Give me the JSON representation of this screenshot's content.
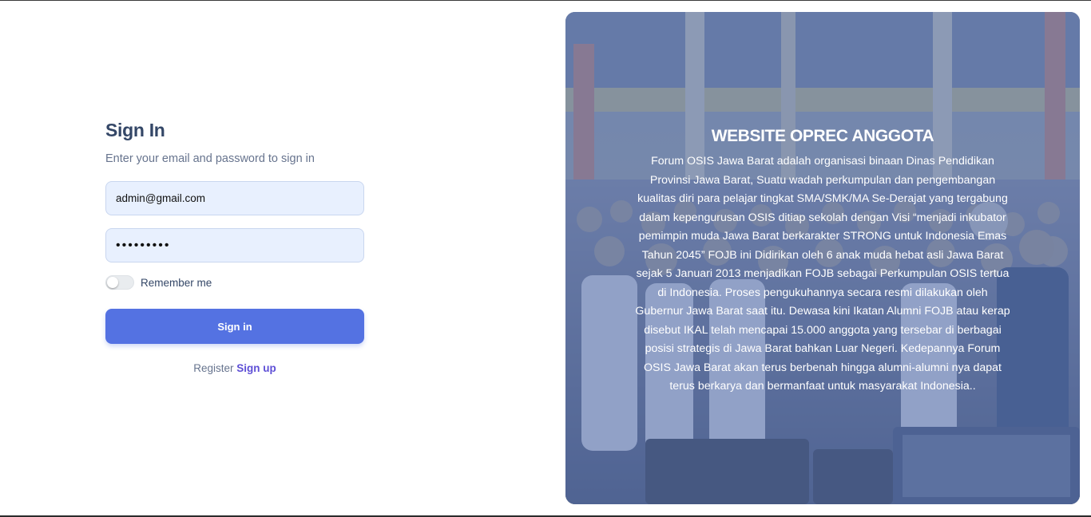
{
  "signin": {
    "title": "Sign In",
    "subtitle": "Enter your email and password to sign in",
    "email_value": "admin@gmail.com",
    "password_value": "•••••••••",
    "remember_label": "Remember me",
    "remember_checked": false,
    "button_label": "Sign in",
    "register_prefix": "Register",
    "signup_link": "Sign up"
  },
  "hero": {
    "title": "WEBSITE OPREC ANGGOTA",
    "text": "Forum OSIS Jawa Barat adalah organisasi binaan Dinas Pendidikan Provinsi Jawa Barat, Suatu wadah perkumpulan dan pengembangan kualitas diri para pelajar tingkat SMA/SMK/MA Se-Derajat yang tergabung dalam kepengurusan OSIS ditiap sekolah dengan Visi “menjadi inkubator pemimpin muda Jawa Barat berkarakter STRONG untuk Indonesia Emas Tahun 2045” FOJB ini Didirikan oleh 6 anak muda hebat asli Jawa Barat sejak 5 Januari 2013 menjadikan FOJB sebagai Perkumpulan OSIS tertua di Indonesia. Proses pengukuhannya secara resmi dilakukan oleh Gubernur Jawa Barat saat itu. Dewasa kini Ikatan Alumni FOJB atau kerap disebut IKAL telah mencapai 15.000 anggota yang tersebar di berbagai posisi strategis di Jawa Barat bahkan Luar Negeri. Kedepannya Forum OSIS Jawa Barat akan terus berbenah hingga alumni-alumni nya dapat terus berkarya dan bermanfaat untuk masyarakat Indonesia..",
    "image": "group-photo-students"
  },
  "colors": {
    "primary": "#5472e2",
    "heading": "#344767",
    "muted": "#67748e",
    "link": "#5e4fd6"
  }
}
